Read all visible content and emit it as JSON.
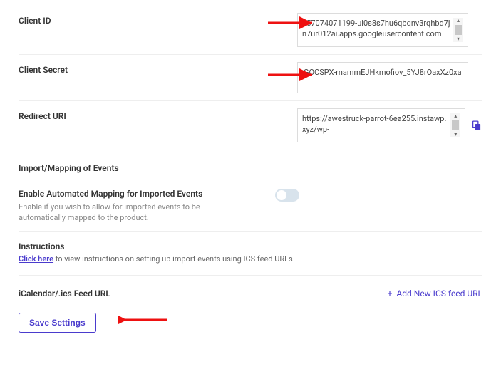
{
  "fields": {
    "client_id": {
      "label": "Client ID",
      "value": "957074071199-ui0s8s7hu6qbqnv3rqhbd7jn7ur012ai.apps.googleusercontent.com"
    },
    "client_secret": {
      "label": "Client Secret",
      "value": "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"
    },
    "redirect_uri": {
      "label": "Redirect URI",
      "value": "https://awestruck-parrot-6ea255.instawp.xyz/wp-"
    }
  },
  "mapping": {
    "section_title": "Import/Mapping of Events",
    "toggle_label": "Enable Automated Mapping for Imported Events",
    "toggle_help": "Enable if you wish to allow for imported events to be automatically mapped to the product.",
    "toggle_on": false
  },
  "instructions": {
    "heading": "Instructions",
    "link_text": "Click here",
    "rest": " to view instructions on setting up import events using ICS feed URLs"
  },
  "ics": {
    "label": "iCalendar/.ics Feed URL",
    "add_label": "Add New ICS feed URL"
  },
  "buttons": {
    "save": "Save Settings"
  }
}
